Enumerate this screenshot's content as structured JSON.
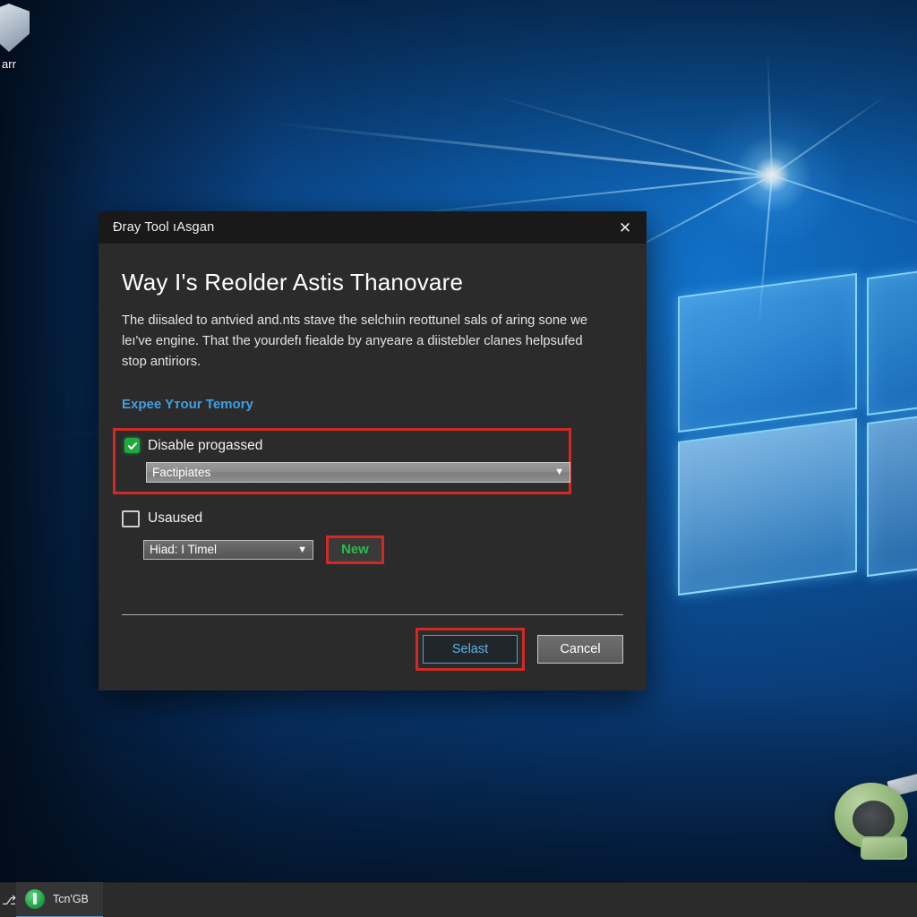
{
  "desktop": {
    "icons": [
      {
        "name": "shield-desktop-icon",
        "caption": "arr"
      },
      {
        "name": "green-disc-desktop-icon",
        "caption": ""
      }
    ]
  },
  "dialog": {
    "title": "Đray Tool ıAsgan",
    "close_label": "✕",
    "heading": "Way I's Reolder Astis Thanovare",
    "paragraph": "The diisaled to antvied and.nts stave the selchıin reottunel sals of aring sone we leı've engine. That the yourdefı fiealde by anyeare a diistebler clanes helpsufed stop antiriors.",
    "help_link": "Expee Yтour Temory",
    "primary_option": {
      "checkbox_label": "Disable progassed",
      "checkbox_state": "checked",
      "select_value": "Factipiates",
      "chevron": "⌄"
    },
    "secondary_option": {
      "checkbox_label": "Usaused",
      "checkbox_state": "unchecked",
      "select_value": "Hiad: I Timel",
      "chevron": "⌄",
      "new_button_label": "New"
    },
    "footer": {
      "primary_label": "Selast",
      "cancel_label": "Cancel"
    }
  },
  "taskbar": {
    "start_glyph": "⎇",
    "app_label": "Tcn'GB"
  },
  "colors": {
    "highlight_red": "#d12a22",
    "accent_blue": "#3ea0e4",
    "checkbox_green": "#1faa3c",
    "new_green": "#22c04a",
    "dialog_bg": "#2b2b2b",
    "titlebar_bg": "#191919"
  }
}
